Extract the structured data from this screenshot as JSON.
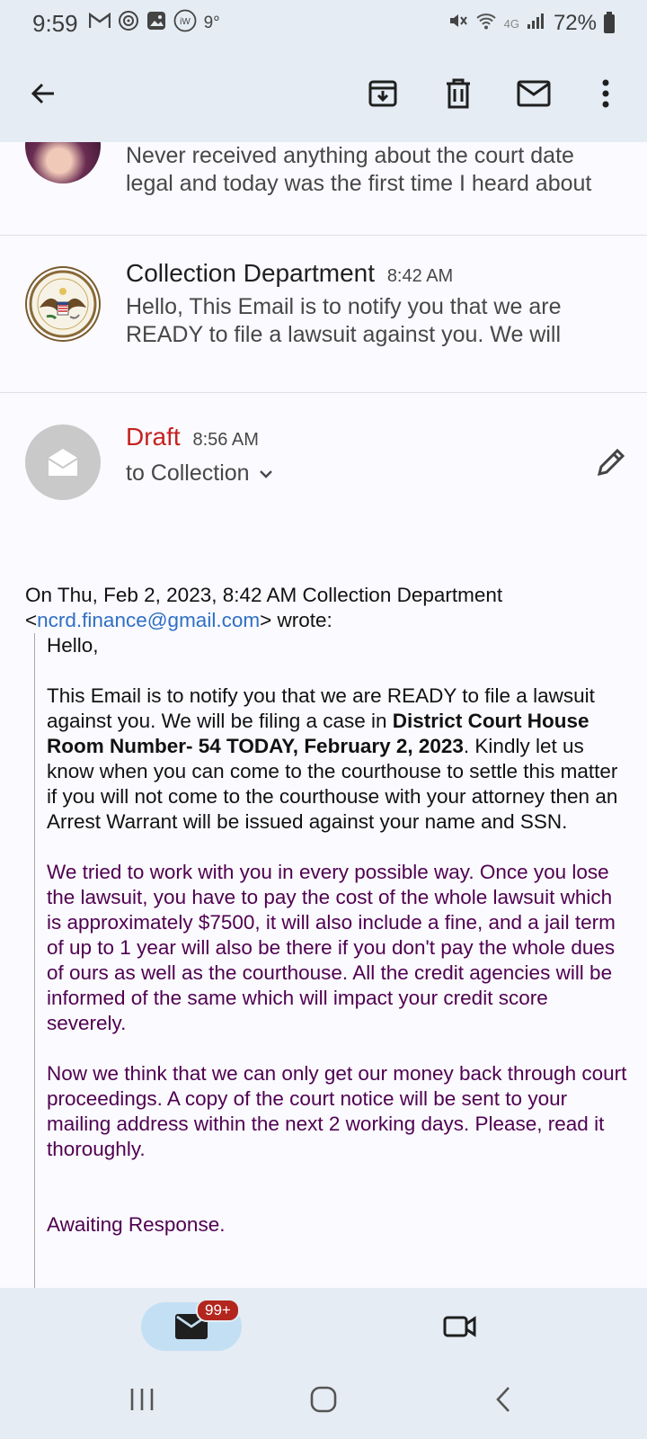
{
  "status_bar": {
    "time": "9:59",
    "temperature": "9°",
    "network": "4G",
    "battery": "72%",
    "left_icons": [
      "gmail-icon",
      "signal-app-icon",
      "gallery-icon",
      "weather-icon"
    ]
  },
  "toolbar": {
    "actions": [
      "back",
      "archive",
      "delete",
      "mark-unread",
      "more-options"
    ]
  },
  "thread": {
    "prev_snippet_line1": "Never received anything about the court date",
    "prev_snippet_line2": "legal and today was the first time I heard about",
    "collection": {
      "sender": "Collection Department",
      "time": "8:42 AM",
      "snippet_line1": "Hello, This Email is to notify you that we are",
      "snippet_line2": "READY to file a lawsuit against you. We will"
    },
    "draft": {
      "label": "Draft",
      "time": "8:56 AM",
      "to": "to Collection"
    }
  },
  "quoted": {
    "header_prefix": "On Thu, Feb 2, 2023, 8:42 AM Collection Department",
    "email_open": "<",
    "email": "ncrd.finance@gmail.com",
    "email_close": "> wrote:",
    "greeting": "Hello,",
    "p1_a": "This Email is to notify you that we are READY to file a lawsuit against you. We will be filing a case in ",
    "p1_bold": "District Court House Room Number- 54  TODAY, February 2, 2023",
    "p1_b": ". Kindly let us know when you can come to the courthouse to settle this matter if you will not come to the courthouse with your attorney then an Arrest Warrant will be issued against your name and SSN.",
    "p2": "We tried to work with you in every possible way. Once you lose the lawsuit, you have to pay the cost of the whole lawsuit which is approximately $7500, it will also include a fine, and a jail term of up to 1 year will also be there if you don't pay the whole dues of ours as well as the courthouse. All the credit agencies will be informed of the same which will impact your credit score severely.",
    "p3": "Now we think that we can only get our money back through court proceedings. A copy of the court notice will be sent to your mailing address within the next 2 working days. Please, read it thoroughly.",
    "closing": "Awaiting Response."
  },
  "bottom_nav": {
    "mail_badge": "99+"
  },
  "colors": {
    "accent": "#c3dff3",
    "draft_red": "#c5221f",
    "quote_purple": "#500050",
    "link_blue": "#2f6fc4"
  }
}
